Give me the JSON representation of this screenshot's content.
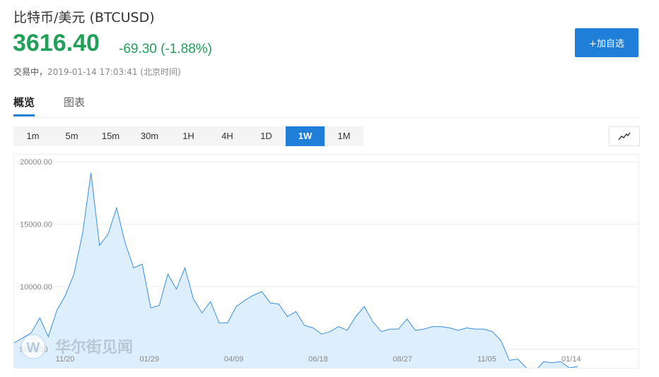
{
  "header": {
    "title": "比特币/美元  (BTCUSD)",
    "price": "3616.40",
    "change": "-69.30 (-1.88%)",
    "status_label": "交易中，",
    "status_time": "2019-01-14 17:03:41 (北京时间)",
    "add_button": "+加自选"
  },
  "tabs": [
    "概览",
    "图表"
  ],
  "ranges": [
    "1m",
    "5m",
    "15m",
    "30m",
    "1H",
    "4H",
    "1D",
    "1W",
    "1M"
  ],
  "active_range": "1W",
  "watermark": "华尔街见闻",
  "colors": {
    "accent": "#1e7ed8",
    "up_down": "#22a05a",
    "area_fill": "#ddeefd",
    "line": "#3a8fe0"
  },
  "chart_data": {
    "type": "area",
    "ytick_labels": [
      "20000.00",
      "15000.00",
      "10000.00",
      "5000.00"
    ],
    "ylim": [
      3500,
      20000
    ],
    "xtick_labels": [
      "11/20",
      "01/29",
      "04/09",
      "06/18",
      "08/27",
      "11/05",
      "01/14"
    ],
    "grid": true,
    "values": [
      5500,
      5900,
      6300,
      7500,
      6000,
      8100,
      9300,
      11000,
      14200,
      19100,
      13300,
      14200,
      16300,
      13500,
      11500,
      11800,
      8300,
      8500,
      11000,
      9800,
      11500,
      9000,
      7900,
      8800,
      7100,
      7100,
      8400,
      8900,
      9300,
      9600,
      8700,
      8600,
      7600,
      8000,
      6900,
      6700,
      6200,
      6400,
      6800,
      6500,
      7600,
      8400,
      7200,
      6400,
      6600,
      6600,
      7400,
      6500,
      6600,
      6800,
      6800,
      6700,
      6500,
      6700,
      6600,
      6600,
      6400,
      5700,
      4100,
      4200,
      3500,
      3200,
      4000,
      3900,
      4000,
      3500,
      3600
    ]
  }
}
